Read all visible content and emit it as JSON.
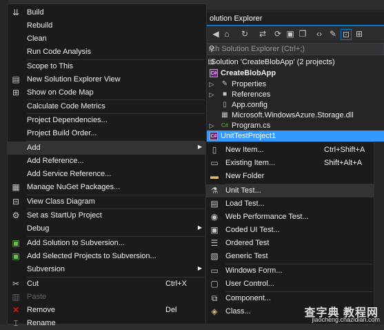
{
  "solution_explorer": {
    "title": "olution Explorer",
    "search_placeholder": "rch Solution Explorer (Ctrl+;)",
    "tree": [
      {
        "text": "Solution 'CreateBlobApp' (2 projects)",
        "icon": "solution-icon"
      },
      {
        "text": "CreateBlobApp",
        "icon": "csharp-project-icon",
        "bold": true
      },
      {
        "text": "Properties",
        "icon": "wrench-icon"
      },
      {
        "text": "References",
        "icon": "references-icon"
      },
      {
        "text": "App.config",
        "icon": "config-file-icon"
      },
      {
        "text": "Microsoft.WindowsAzure.Storage.dll",
        "icon": "dll-icon"
      },
      {
        "text": "Program.cs",
        "icon": "csharp-file-icon"
      },
      {
        "text": "UnitTestProject1",
        "icon": "csharp-project-icon",
        "selected": true
      }
    ]
  },
  "context_menu": {
    "items": [
      {
        "label": "Build",
        "icon": "build-icon"
      },
      {
        "label": "Rebuild"
      },
      {
        "label": "Clean"
      },
      {
        "label": "Run Code Analysis"
      },
      {
        "label": "Scope to This"
      },
      {
        "label": "New Solution Explorer View",
        "icon": "new-view-icon"
      },
      {
        "label": "Show on Code Map",
        "icon": "code-map-icon"
      },
      {
        "label": "Calculate Code Metrics"
      },
      {
        "label": "Project Dependencies..."
      },
      {
        "label": "Project Build Order..."
      },
      {
        "label": "Add",
        "submenu": true,
        "highlighted": true
      },
      {
        "label": "Add Reference..."
      },
      {
        "label": "Add Service Reference..."
      },
      {
        "label": "Manage NuGet Packages...",
        "icon": "nuget-icon"
      },
      {
        "label": "View Class Diagram",
        "icon": "class-diagram-icon"
      },
      {
        "label": "Set as StartUp Project",
        "icon": "gear-icon"
      },
      {
        "label": "Debug",
        "submenu": true
      },
      {
        "label": "Add Solution to Subversion...",
        "icon": "subversion-add-icon"
      },
      {
        "label": "Add Selected Projects to Subversion...",
        "icon": "subversion-add-icon"
      },
      {
        "label": "Subversion",
        "submenu": true
      },
      {
        "label": "Cut",
        "icon": "scissors-icon",
        "shortcut": "Ctrl+X"
      },
      {
        "label": "Paste",
        "icon": "paste-icon",
        "disabled": true
      },
      {
        "label": "Remove",
        "icon": "remove-icon",
        "shortcut": "Del"
      },
      {
        "label": "Rename",
        "icon": "rename-icon"
      }
    ]
  },
  "add_submenu": {
    "items": [
      {
        "label": "New Item...",
        "icon": "new-item-icon",
        "shortcut": "Ctrl+Shift+A"
      },
      {
        "label": "Existing Item...",
        "icon": "existing-item-icon",
        "shortcut": "Shift+Alt+A"
      },
      {
        "label": "New Folder",
        "icon": "folder-icon"
      },
      {
        "label": "Unit Test...",
        "icon": "unit-test-icon",
        "highlighted": true
      },
      {
        "label": "Load Test...",
        "icon": "load-test-icon"
      },
      {
        "label": "Web Performance Test...",
        "icon": "web-test-icon"
      },
      {
        "label": "Coded UI Test...",
        "icon": "coded-ui-test-icon"
      },
      {
        "label": "Ordered Test",
        "icon": "ordered-test-icon"
      },
      {
        "label": "Generic Test",
        "icon": "generic-test-icon"
      },
      {
        "label": "Windows Form...",
        "icon": "windows-form-icon"
      },
      {
        "label": "User Control...",
        "icon": "user-control-icon"
      },
      {
        "label": "Component...",
        "icon": "component-icon"
      },
      {
        "label": "Class...",
        "icon": "class-icon"
      }
    ]
  },
  "watermark": {
    "text_cn": "查字典 教程网",
    "url": "jiaocheng.chazidian.com"
  },
  "colors": {
    "accent": "#007acc",
    "selection": "#3399ff",
    "menu_bg": "#1b1b1c",
    "menu_highlight": "#333334"
  }
}
